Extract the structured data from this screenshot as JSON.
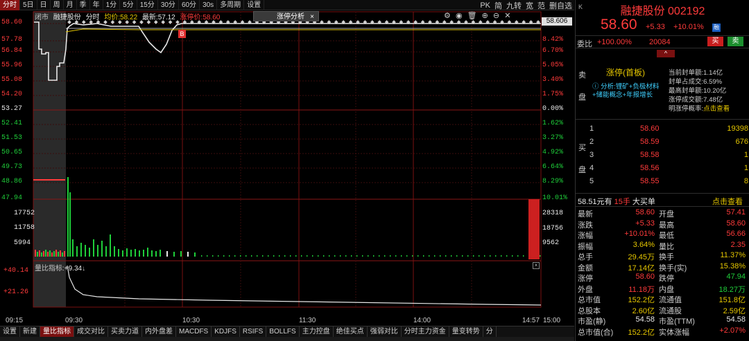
{
  "toolbar": {
    "items": [
      "分时",
      "5日",
      "日",
      "周",
      "月",
      "季",
      "年",
      "1分",
      "5分",
      "15分",
      "30分",
      "60分",
      "30s",
      "多周期",
      "设置"
    ],
    "right_items": [
      "PK",
      "简",
      "九转",
      "宽",
      "范",
      "删自选"
    ]
  },
  "chart_info": {
    "mode": "闭市",
    "name": "融捷股份",
    "type": "分时",
    "avg_label": "均价:",
    "avg_value": "58.22",
    "latest_label": "最新:",
    "latest_value": "57.12",
    "limit_label": "涨停价:",
    "limit_value": "58.60",
    "tab_label": "涨停分析",
    "tab_close": "×",
    "last_price_tag": "58.606",
    "b_marker": "B"
  },
  "price_axis_left": [
    {
      "v": "58.60",
      "c": "red"
    },
    {
      "v": "57.78",
      "c": "red"
    },
    {
      "v": "56.84",
      "c": "red"
    },
    {
      "v": "55.96",
      "c": "red"
    },
    {
      "v": "55.08",
      "c": "red"
    },
    {
      "v": "54.20",
      "c": "red"
    },
    {
      "v": "53.27",
      "c": "white"
    },
    {
      "v": "52.41",
      "c": "green"
    },
    {
      "v": "51.53",
      "c": "green"
    },
    {
      "v": "50.65",
      "c": "green"
    },
    {
      "v": "49.73",
      "c": "green"
    },
    {
      "v": "48.86",
      "c": "green"
    },
    {
      "v": "47.94",
      "c": "green"
    }
  ],
  "pct_axis_right": [
    {
      "v": "10.01%",
      "c": "red"
    },
    {
      "v": "8.42%",
      "c": "red"
    },
    {
      "v": "6.70%",
      "c": "red"
    },
    {
      "v": "5.05%",
      "c": "red"
    },
    {
      "v": "3.40%",
      "c": "red"
    },
    {
      "v": "1.75%",
      "c": "red"
    },
    {
      "v": "0.00%",
      "c": "white"
    },
    {
      "v": "1.62%",
      "c": "green"
    },
    {
      "v": "3.27%",
      "c": "green"
    },
    {
      "v": "4.92%",
      "c": "green"
    },
    {
      "v": "6.64%",
      "c": "green"
    },
    {
      "v": "8.29%",
      "c": "green"
    },
    {
      "v": "10.01%",
      "c": "green"
    }
  ],
  "volume_axis_left": [
    "17752",
    "11758",
    "5994"
  ],
  "volume_axis_right": [
    "28318",
    "18756",
    "9562"
  ],
  "indicator": {
    "name": "量比指标:",
    "value": "+9.34",
    "close": "×",
    "axis_left": [
      "+40.14",
      "+21.26"
    ]
  },
  "time_labels": [
    "09:15",
    "09:30",
    "10:30",
    "11:30",
    "14:00",
    "14:57",
    "15:00"
  ],
  "bottom_tabs": [
    "设置",
    "新建",
    "量比指标",
    "成交对比",
    "买卖力道",
    "内外盘差",
    "MACDFS",
    "KDJFS",
    "RSIFS",
    "BOLLFS",
    "主力控盘",
    "绝佳买点",
    "强弱对比",
    "分时主力资金",
    "量变转势",
    "分"
  ],
  "right_panel": {
    "k_label": "K",
    "stock_name": "融捷股份",
    "stock_code": "002192",
    "price": "58.60",
    "change": "+5.33",
    "change_pct": "+10.01%",
    "rz_badge": "融",
    "weibi_label": "委比",
    "weibi_value": "+100.00%",
    "weicha_value": "20084",
    "buy_btn": "买",
    "sell_btn": "卖",
    "up_caret": "^",
    "sell_side_label": [
      "卖",
      "盘"
    ],
    "buy_side_label": [
      "买",
      "盘"
    ],
    "limit_title": "涨停(首板)",
    "analysis_text": "分析:锂矿+负极材料+储能概念+年报增长",
    "stats": [
      {
        "label": "当前封单额:",
        "value": "1.14亿"
      },
      {
        "label": "封单占成交:",
        "value": "6.59%"
      },
      {
        "label": "最高封单额:",
        "value": "10.20亿"
      },
      {
        "label": "涨停成交额:",
        "value": "7.48亿"
      },
      {
        "label": "明涨停概率:",
        "value": "点击查看"
      }
    ],
    "order_book": [
      {
        "n": "1",
        "p": "58.60",
        "v": "19398"
      },
      {
        "n": "2",
        "p": "58.59",
        "v": "676"
      },
      {
        "n": "3",
        "p": "58.58",
        "v": "1"
      },
      {
        "n": "4",
        "p": "58.56",
        "v": "1"
      },
      {
        "n": "5",
        "p": "58.55",
        "v": "8"
      }
    ],
    "big_buy": "58.51元有",
    "big_buy_hands": "15手",
    "big_buy_label": "大买单",
    "big_buy_link": "点击查看",
    "quote": [
      {
        "l1": "最新",
        "v1": "58.60",
        "c1": "red",
        "l2": "开盘",
        "v2": "57.41",
        "c2": "red"
      },
      {
        "l1": "涨跌",
        "v1": "+5.33",
        "c1": "red",
        "l2": "最高",
        "v2": "58.60",
        "c2": "red"
      },
      {
        "l1": "涨幅",
        "v1": "+10.01%",
        "c1": "red",
        "l2": "最低",
        "v2": "56.66",
        "c2": "red"
      },
      {
        "l1": "振幅",
        "v1": "3.64%",
        "c1": "yellow",
        "l2": "量比",
        "v2": "2.35",
        "c2": "red"
      },
      {
        "l1": "总手",
        "v1": "29.45万",
        "c1": "yellow",
        "l2": "换手",
        "v2": "11.37%",
        "c2": "yellow"
      },
      {
        "l1": "金额",
        "v1": "17.14亿",
        "c1": "yellow",
        "l2": "换手(实)",
        "v2": "15.38%",
        "c2": "yellow"
      },
      {
        "l1": "涨停",
        "v1": "58.60",
        "c1": "red",
        "l2": "跌停",
        "v2": "47.94",
        "c2": "green"
      },
      {
        "l1": "外盘",
        "v1": "11.18万",
        "c1": "red",
        "l2": "内盘",
        "v2": "18.27万",
        "c2": "green"
      },
      {
        "l1": "总市值",
        "v1": "152.2亿",
        "c1": "yellow",
        "l2": "流通值",
        "v2": "151.8亿",
        "c2": "yellow"
      },
      {
        "l1": "总股本",
        "v1": "2.60亿",
        "c1": "yellow",
        "l2": "流通股",
        "v2": "2.59亿",
        "c2": "yellow"
      },
      {
        "l1": "市盈(静)",
        "v1": "54.58",
        "c1": "white",
        "l2": "市盈(TTM)",
        "v2": "54.58",
        "c2": "white"
      },
      {
        "l1": "总市值(合)",
        "v1": "152.2亿",
        "c1": "yellow",
        "l2": "实体涨幅",
        "v2": "+2.07%",
        "c2": "red"
      }
    ]
  },
  "colors": {
    "up": "#ff3b3b",
    "down": "#1fcf3a",
    "line": "#e8e8e8",
    "avg": "#e6c700",
    "grid": "#5a0f0f"
  }
}
